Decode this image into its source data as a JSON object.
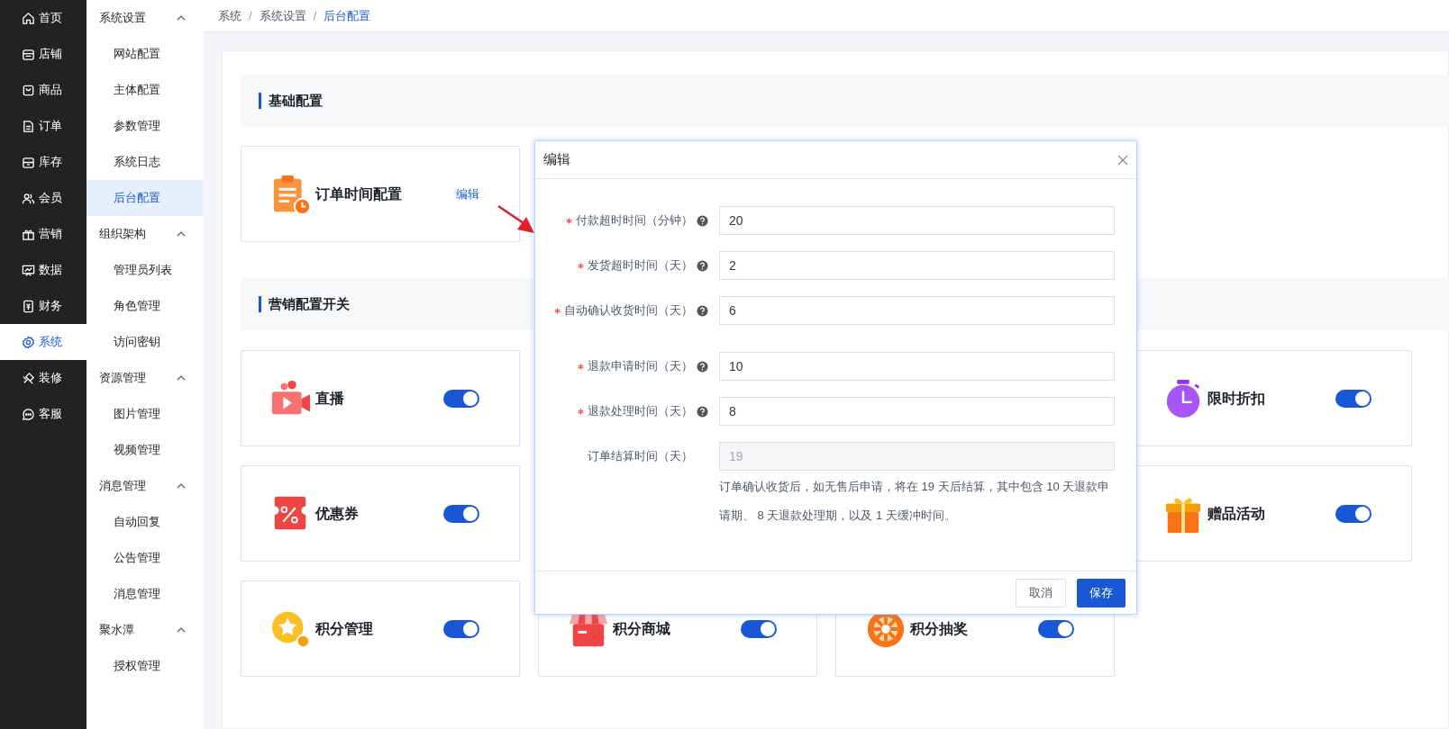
{
  "main_menu": [
    {
      "label": "首页",
      "selected": false
    },
    {
      "label": "店铺",
      "selected": false
    },
    {
      "label": "商品",
      "selected": false
    },
    {
      "label": "订单",
      "selected": false
    },
    {
      "label": "库存",
      "selected": false
    },
    {
      "label": "会员",
      "selected": false
    },
    {
      "label": "营销",
      "selected": false
    },
    {
      "label": "数据",
      "selected": false
    },
    {
      "label": "财务",
      "selected": false
    },
    {
      "label": "系统",
      "selected": true
    },
    {
      "label": "装修",
      "selected": false
    },
    {
      "label": "客服",
      "selected": false
    }
  ],
  "sub_menu": [
    {
      "label": "系统设置",
      "expanded": true,
      "children": [
        {
          "label": "网站配置",
          "selected": false
        },
        {
          "label": "主体配置",
          "selected": false
        },
        {
          "label": "参数管理",
          "selected": false
        },
        {
          "label": "系统日志",
          "selected": false
        },
        {
          "label": "后台配置",
          "selected": true
        }
      ]
    },
    {
      "label": "组织架构",
      "expanded": true,
      "children": [
        {
          "label": "管理员列表",
          "selected": false
        },
        {
          "label": "角色管理",
          "selected": false
        },
        {
          "label": "访问密钥",
          "selected": false
        }
      ]
    },
    {
      "label": "资源管理",
      "expanded": true,
      "children": [
        {
          "label": "图片管理",
          "selected": false
        },
        {
          "label": "视频管理",
          "selected": false
        }
      ]
    },
    {
      "label": "消息管理",
      "expanded": true,
      "children": [
        {
          "label": "自动回复",
          "selected": false
        },
        {
          "label": "公告管理",
          "selected": false
        },
        {
          "label": "消息管理",
          "selected": false
        }
      ]
    },
    {
      "label": "聚水潭",
      "expanded": true,
      "children": [
        {
          "label": "授权管理",
          "selected": false
        }
      ]
    }
  ],
  "breadcrumb": {
    "separator": "/",
    "items": [
      "系统",
      "系统设置",
      "后台配置"
    ]
  },
  "basic_section": {
    "title": "基础配置",
    "cards": [
      {
        "title": "订单时间配置",
        "action": "编辑"
      }
    ]
  },
  "marketing_section": {
    "title": "营销配置开关",
    "cards": [
      {
        "title": "直播",
        "on": true
      },
      {
        "title": "限时折扣",
        "on": true
      },
      {
        "title": "优惠券",
        "on": true
      },
      {
        "title": "赠品活动",
        "on": true
      },
      {
        "title": "积分管理",
        "on": true
      },
      {
        "title": "积分商城",
        "on": true
      },
      {
        "title": "积分抽奖",
        "on": true
      }
    ]
  },
  "dialog": {
    "title": "编辑",
    "fields": [
      {
        "label": "付款超时时间（分钟）",
        "required": true,
        "help": true,
        "value": "20",
        "disabled": false
      },
      {
        "label": "发货超时时间（天）",
        "required": true,
        "help": true,
        "value": "2",
        "disabled": false
      },
      {
        "label": "自动确认收货时间（天）",
        "required": true,
        "help": true,
        "value": "6",
        "disabled": false
      },
      {
        "label": "退款申请时间（天）",
        "required": true,
        "help": true,
        "value": "10",
        "disabled": false
      },
      {
        "label": "退款处理时间（天）",
        "required": true,
        "help": true,
        "value": "8",
        "disabled": false
      },
      {
        "label": "订单结算时间（天）",
        "required": false,
        "help": false,
        "value": "19",
        "disabled": true
      }
    ],
    "hint": "订单确认收货后，如无售后申请，将在 19 天后结算，其中包含 10 天退款申请期、 8 天退款处理期，以及 1 天缓冲时间。",
    "buttons": [
      {
        "label": "取消",
        "kind": "secondary"
      },
      {
        "label": "保存",
        "kind": "primary"
      }
    ]
  }
}
